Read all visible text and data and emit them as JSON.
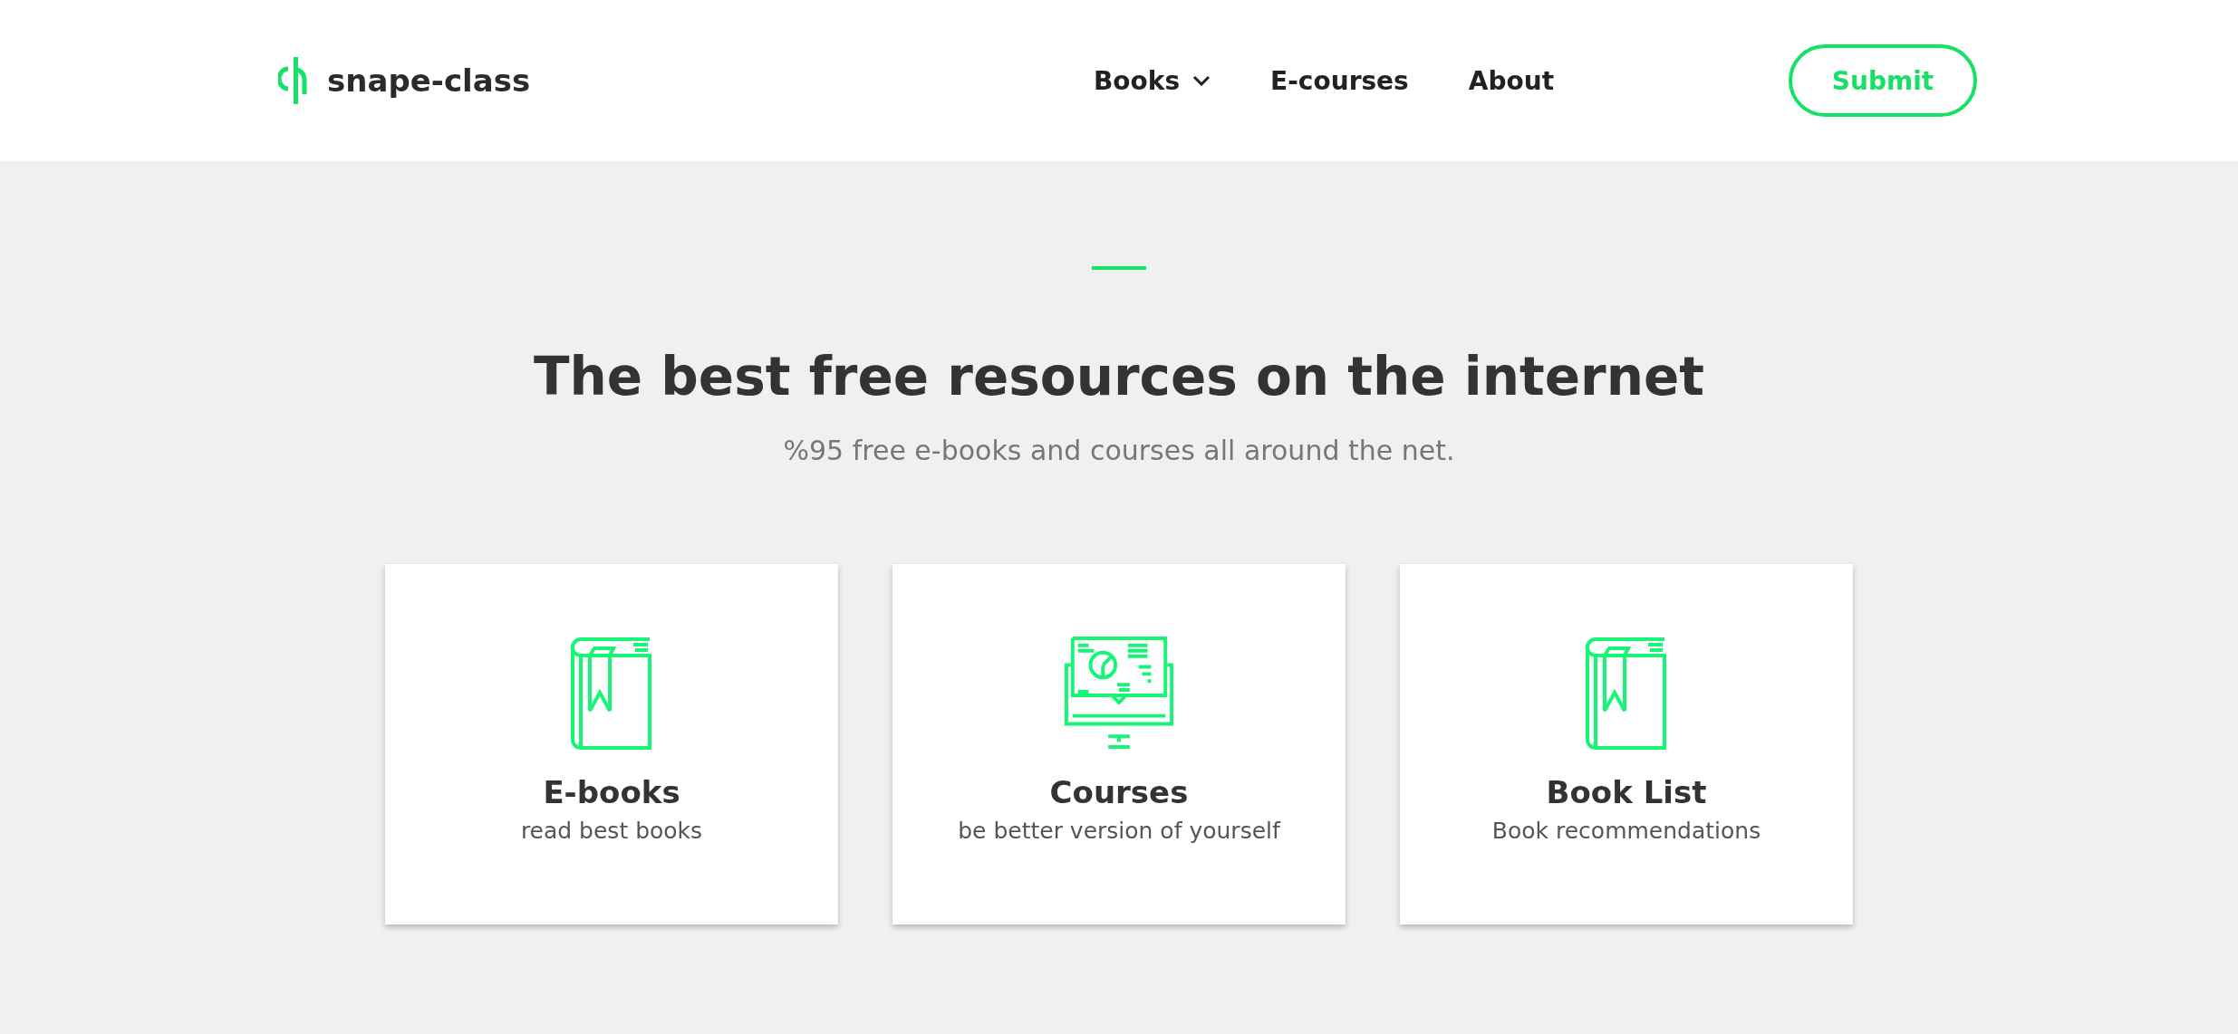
{
  "header": {
    "logo": {
      "text": "snape-class"
    },
    "nav": [
      {
        "label": "Books",
        "dropdown": true
      },
      {
        "label": "E-courses",
        "dropdown": false
      },
      {
        "label": "About",
        "dropdown": false
      }
    ],
    "submit_button": "Submit"
  },
  "hero": {
    "title": "The best free resources on the internet",
    "subtitle": "%95 free e-books and courses all around the net."
  },
  "cards": [
    {
      "kind": "book",
      "title": "E-books",
      "subtitle": "read best books"
    },
    {
      "kind": "monitor",
      "title": "Courses",
      "subtitle": "be better version of yourself"
    },
    {
      "kind": "book",
      "title": "Book List",
      "subtitle": "Book recommendations"
    }
  ]
}
